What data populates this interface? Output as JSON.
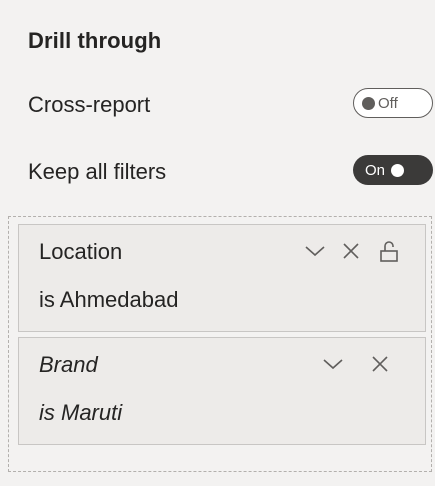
{
  "drill_through": {
    "title": "Drill through",
    "cross_report": {
      "label": "Cross-report",
      "toggle_text": "Off",
      "state": "off"
    },
    "keep_all_filters": {
      "label": "Keep all filters",
      "toggle_text": "On",
      "state": "on"
    },
    "filters": [
      {
        "field": "Location",
        "value": "is Ahmedabad",
        "icons": [
          "chevron-down-icon",
          "close-icon",
          "unlock-icon"
        ]
      },
      {
        "field": "Brand",
        "value": "is Maruti",
        "icons": [
          "chevron-down-icon",
          "close-icon"
        ]
      }
    ]
  },
  "colors": {
    "background": "#f3f2f1",
    "card_background": "#edebe9",
    "card_border": "#c8c6c4",
    "toggle_on_bg": "#3b3a39",
    "icon": "#605e5c",
    "text": "#252423"
  }
}
